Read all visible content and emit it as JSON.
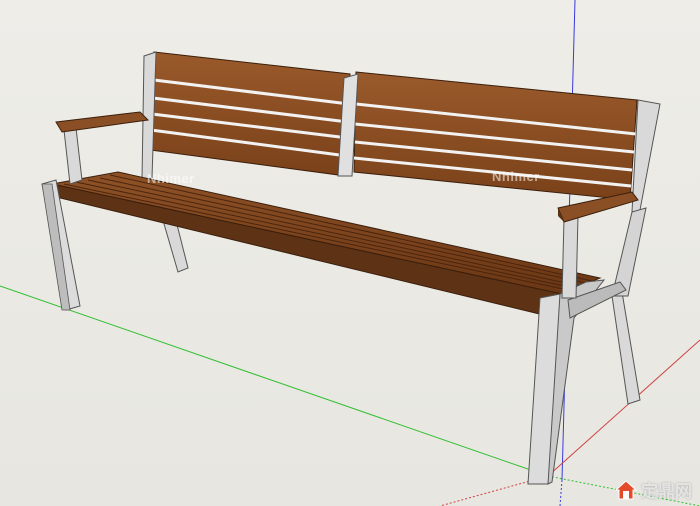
{
  "watermarks": [
    "Nhimer",
    "Nhimer"
  ],
  "brand": {
    "text": "定鼎网"
  },
  "icons": {
    "brand": "house-logo-icon"
  },
  "colors": {
    "background": "#ecebe6",
    "wood": "#8a4f24",
    "wood_dark": "#5e3215",
    "metal": "#d9d9d9",
    "metal_shadow": "#b5b5b5",
    "axis_red": "#d04040",
    "axis_green": "#2fbf2f",
    "axis_blue": "#3a3ae0"
  }
}
